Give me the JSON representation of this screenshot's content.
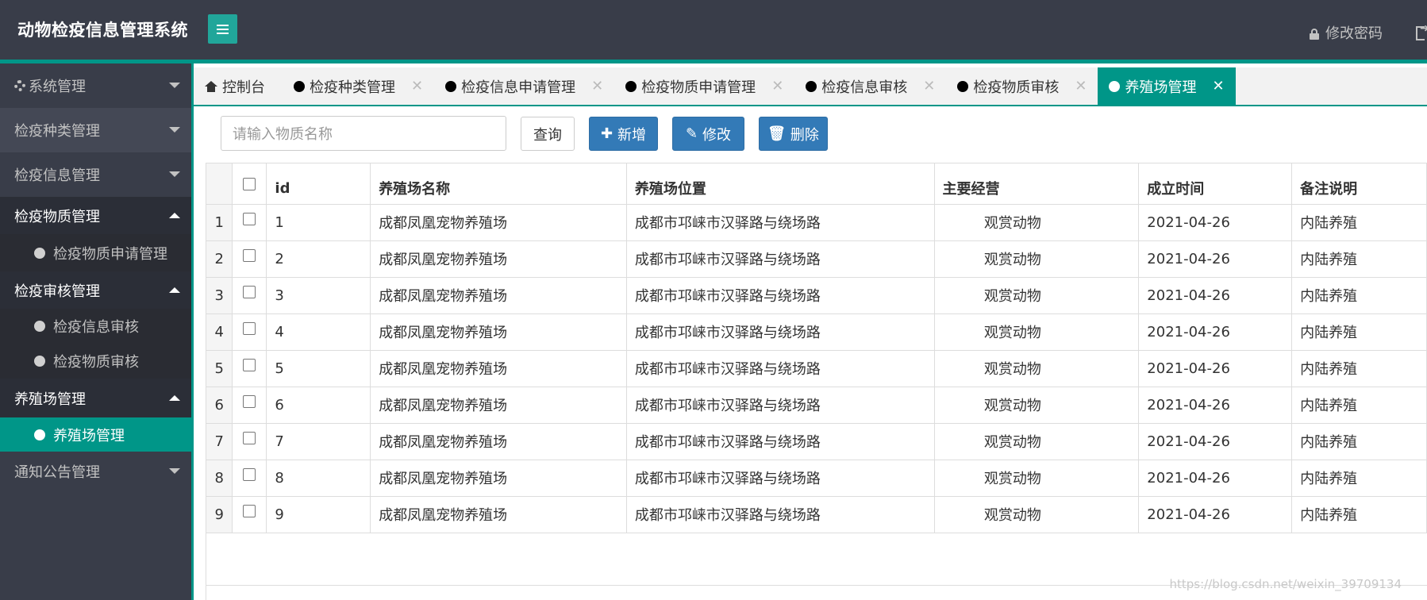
{
  "app": {
    "title": "动物检疫信息管理系统"
  },
  "header": {
    "change_password": "修改密码"
  },
  "sidebar": {
    "groups": [
      {
        "label": "系统管理",
        "expanded": false
      },
      {
        "label": "检疫种类管理",
        "expanded": false
      },
      {
        "label": "检疫信息管理",
        "expanded": false
      },
      {
        "label": "检疫物质管理",
        "expanded": true,
        "items": [
          "检疫物质申请管理"
        ]
      },
      {
        "label": "检疫审核管理",
        "expanded": true,
        "items": [
          "检疫信息审核",
          "检疫物质审核"
        ]
      },
      {
        "label": "养殖场管理",
        "expanded": true,
        "items": [
          "养殖场管理"
        ]
      },
      {
        "label": "通知公告管理",
        "expanded": false
      }
    ]
  },
  "tabs": [
    {
      "label": "控制台",
      "icon": "home-icon"
    },
    {
      "label": "检疫种类管理",
      "closable": true
    },
    {
      "label": "检疫信息申请管理",
      "closable": true
    },
    {
      "label": "检疫物质申请管理",
      "closable": true
    },
    {
      "label": "检疫信息审核",
      "closable": true
    },
    {
      "label": "检疫物质审核",
      "closable": true
    },
    {
      "label": "养殖场管理",
      "closable": true,
      "active": true
    }
  ],
  "toolbar": {
    "search_placeholder": "请输入物质名称",
    "query_label": "查询",
    "add_label": "新增",
    "edit_label": "修改",
    "delete_label": "删除"
  },
  "table": {
    "columns": [
      "id",
      "养殖场名称",
      "养殖场位置",
      "主要经营",
      "成立时间",
      "备注说明"
    ],
    "rows": [
      [
        "1",
        "1",
        "成都凤凰宠物养殖场",
        "成都市邛崃市汉驿路与绕场路",
        "观赏动物",
        "2021-04-26",
        "内陆养殖"
      ],
      [
        "2",
        "2",
        "成都凤凰宠物养殖场",
        "成都市邛崃市汉驿路与绕场路",
        "观赏动物",
        "2021-04-26",
        "内陆养殖"
      ],
      [
        "3",
        "3",
        "成都凤凰宠物养殖场",
        "成都市邛崃市汉驿路与绕场路",
        "观赏动物",
        "2021-04-26",
        "内陆养殖"
      ],
      [
        "4",
        "4",
        "成都凤凰宠物养殖场",
        "成都市邛崃市汉驿路与绕场路",
        "观赏动物",
        "2021-04-26",
        "内陆养殖"
      ],
      [
        "5",
        "5",
        "成都凤凰宠物养殖场",
        "成都市邛崃市汉驿路与绕场路",
        "观赏动物",
        "2021-04-26",
        "内陆养殖"
      ],
      [
        "6",
        "6",
        "成都凤凰宠物养殖场",
        "成都市邛崃市汉驿路与绕场路",
        "观赏动物",
        "2021-04-26",
        "内陆养殖"
      ],
      [
        "7",
        "7",
        "成都凤凰宠物养殖场",
        "成都市邛崃市汉驿路与绕场路",
        "观赏动物",
        "2021-04-26",
        "内陆养殖"
      ],
      [
        "8",
        "8",
        "成都凤凰宠物养殖场",
        "成都市邛崃市汉驿路与绕场路",
        "观赏动物",
        "2021-04-26",
        "内陆养殖"
      ],
      [
        "9",
        "9",
        "成都凤凰宠物养殖场",
        "成都市邛崃市汉驿路与绕场路",
        "观赏动物",
        "2021-04-26",
        "内陆养殖"
      ]
    ]
  },
  "watermark": "https://blog.csdn.net/weixin_39709134",
  "colors": {
    "accent": "#009688",
    "header_bg": "#393d49",
    "primary_btn": "#337ab7"
  }
}
